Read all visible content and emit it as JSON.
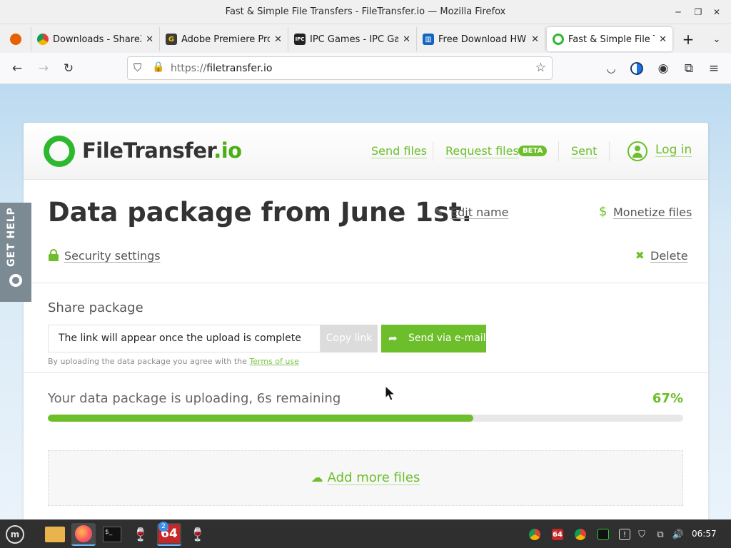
{
  "window": {
    "title": "Fast & Simple File Transfers - FileTransfer.io — Mozilla Firefox",
    "minimize_icon": "minimize-icon",
    "maximize_icon": "maximize-icon",
    "close_icon": "close-icon"
  },
  "tabs": [
    {
      "label": "Downloads - ShareX",
      "icon": "chrome-icon",
      "active": false
    },
    {
      "label": "Adobe Premiere Pro",
      "icon": "g-icon",
      "active": false
    },
    {
      "label": "IPC Games - IPC Gam",
      "icon": "ipc-icon",
      "active": false
    },
    {
      "label": "Free Download HWi",
      "icon": "hwinfo-icon",
      "active": false
    },
    {
      "label": "Fast & Simple File Tr",
      "icon": "filetransfer-icon",
      "active": true
    }
  ],
  "urlbar": {
    "protocol": "https://",
    "host": "filetransfer.io"
  },
  "site": {
    "logo_main": "FileTransfer",
    "logo_suffix": ".io",
    "nav": {
      "send_files": "Send files",
      "request_files": "Request files",
      "beta": "BETA",
      "sent": "Sent",
      "log_in": "Log in"
    },
    "title": "Data package from June 1st.",
    "edit_name": "Edit name",
    "monetize": "Monetize files",
    "security": "Security settings",
    "delete": "Delete",
    "share": {
      "title": "Share package",
      "input_value": "The link will appear once the upload is complete",
      "copy_link": "Copy link",
      "send_email": "Send via e-mail",
      "terms_prefix": "By uploading the data package you agree with the",
      "terms_link": "Terms of use"
    },
    "upload": {
      "status": "Your data package is uploading, 6s remaining",
      "percent_label": "67%",
      "progress": 0.67
    },
    "add_more": "Add more files",
    "get_help": "GET HELP"
  },
  "taskbar": {
    "clock": "06:57",
    "badge": "2",
    "app64": "64"
  },
  "colors": {
    "accent": "#6cbe2a",
    "brand_dark": "#333333"
  }
}
